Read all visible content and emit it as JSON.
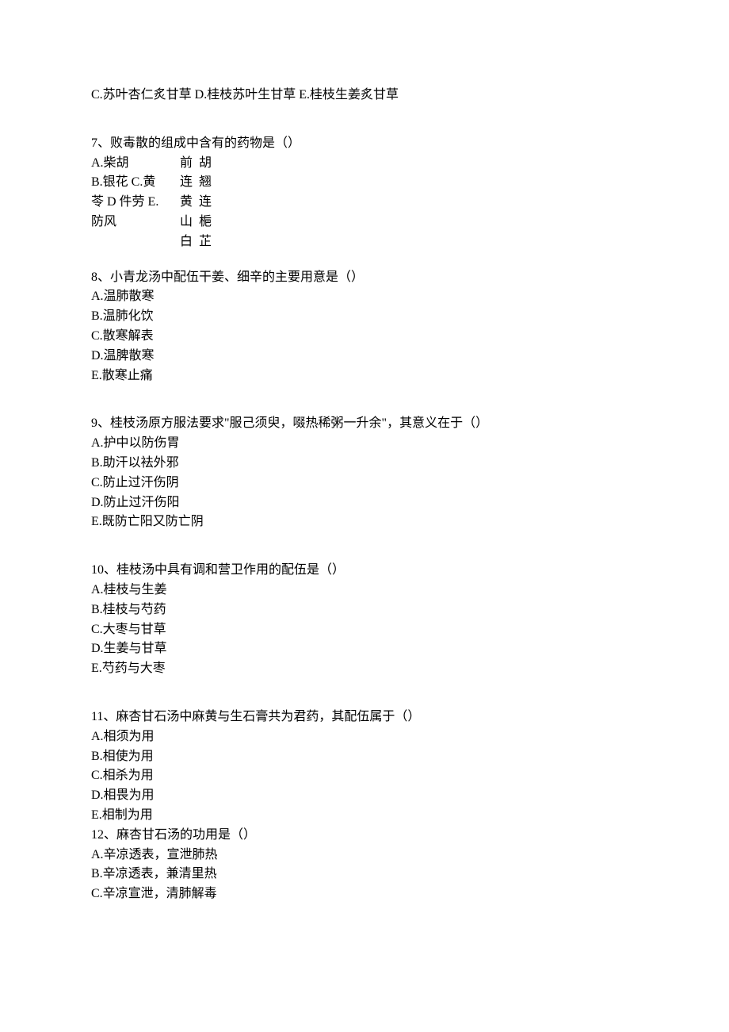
{
  "top_line": "C.苏叶杏仁炙甘草 D.桂枝苏叶生甘草 E.桂枝生姜炙甘草",
  "q7": {
    "stem": "7、败毒散的组成中含有的药物是（）",
    "left": [
      "A.柴胡",
      "B.银花 C.黄",
      "苓 D 件劳 E.",
      "防风"
    ],
    "right": [
      "前 胡",
      "连 翘",
      "黄 连",
      "山 梔",
      "白 芷"
    ]
  },
  "q8": {
    "stem": "8、小青龙汤中配伍干姜、细辛的主要用意是（）",
    "opts": [
      "A.温肺散寒",
      "B.温肺化饮",
      "C.散寒解表",
      "D.温脾散寒",
      "E.散寒止痛"
    ]
  },
  "q9": {
    "stem": "9、桂枝汤原方服法要求\"服己须臾，啜热稀粥一升余\"，其意义在于（）",
    "opts": [
      "A.护中以防伤胃",
      "B.助汗以袪外邪",
      "C.防止过汗伤阴",
      "D.防止过汗伤阳",
      "E.既防亡阳又防亡阴"
    ]
  },
  "q10": {
    "stem": "10、桂枝汤中具有调和营卫作用的配伍是（）",
    "opts": [
      "A.桂枝与生姜",
      "B.桂枝与芍药",
      "C.大枣与甘草",
      "D.生姜与甘草",
      "E.芍药与大枣"
    ]
  },
  "q11": {
    "stem": "11、麻杏甘石汤中麻黄与生石膏共为君药，其配伍属于（）",
    "opts": [
      "A.相须为用",
      "B.相使为用",
      "C.相杀为用",
      "D.相畏为用",
      "E.相制为用"
    ]
  },
  "q12": {
    "stem": "12、麻杏甘石汤的功用是（）",
    "opts": [
      "A.辛凉透表，宣泄肺热",
      "B.辛凉透表，兼清里热",
      "C.辛凉宣泄，清肺解毒"
    ]
  }
}
